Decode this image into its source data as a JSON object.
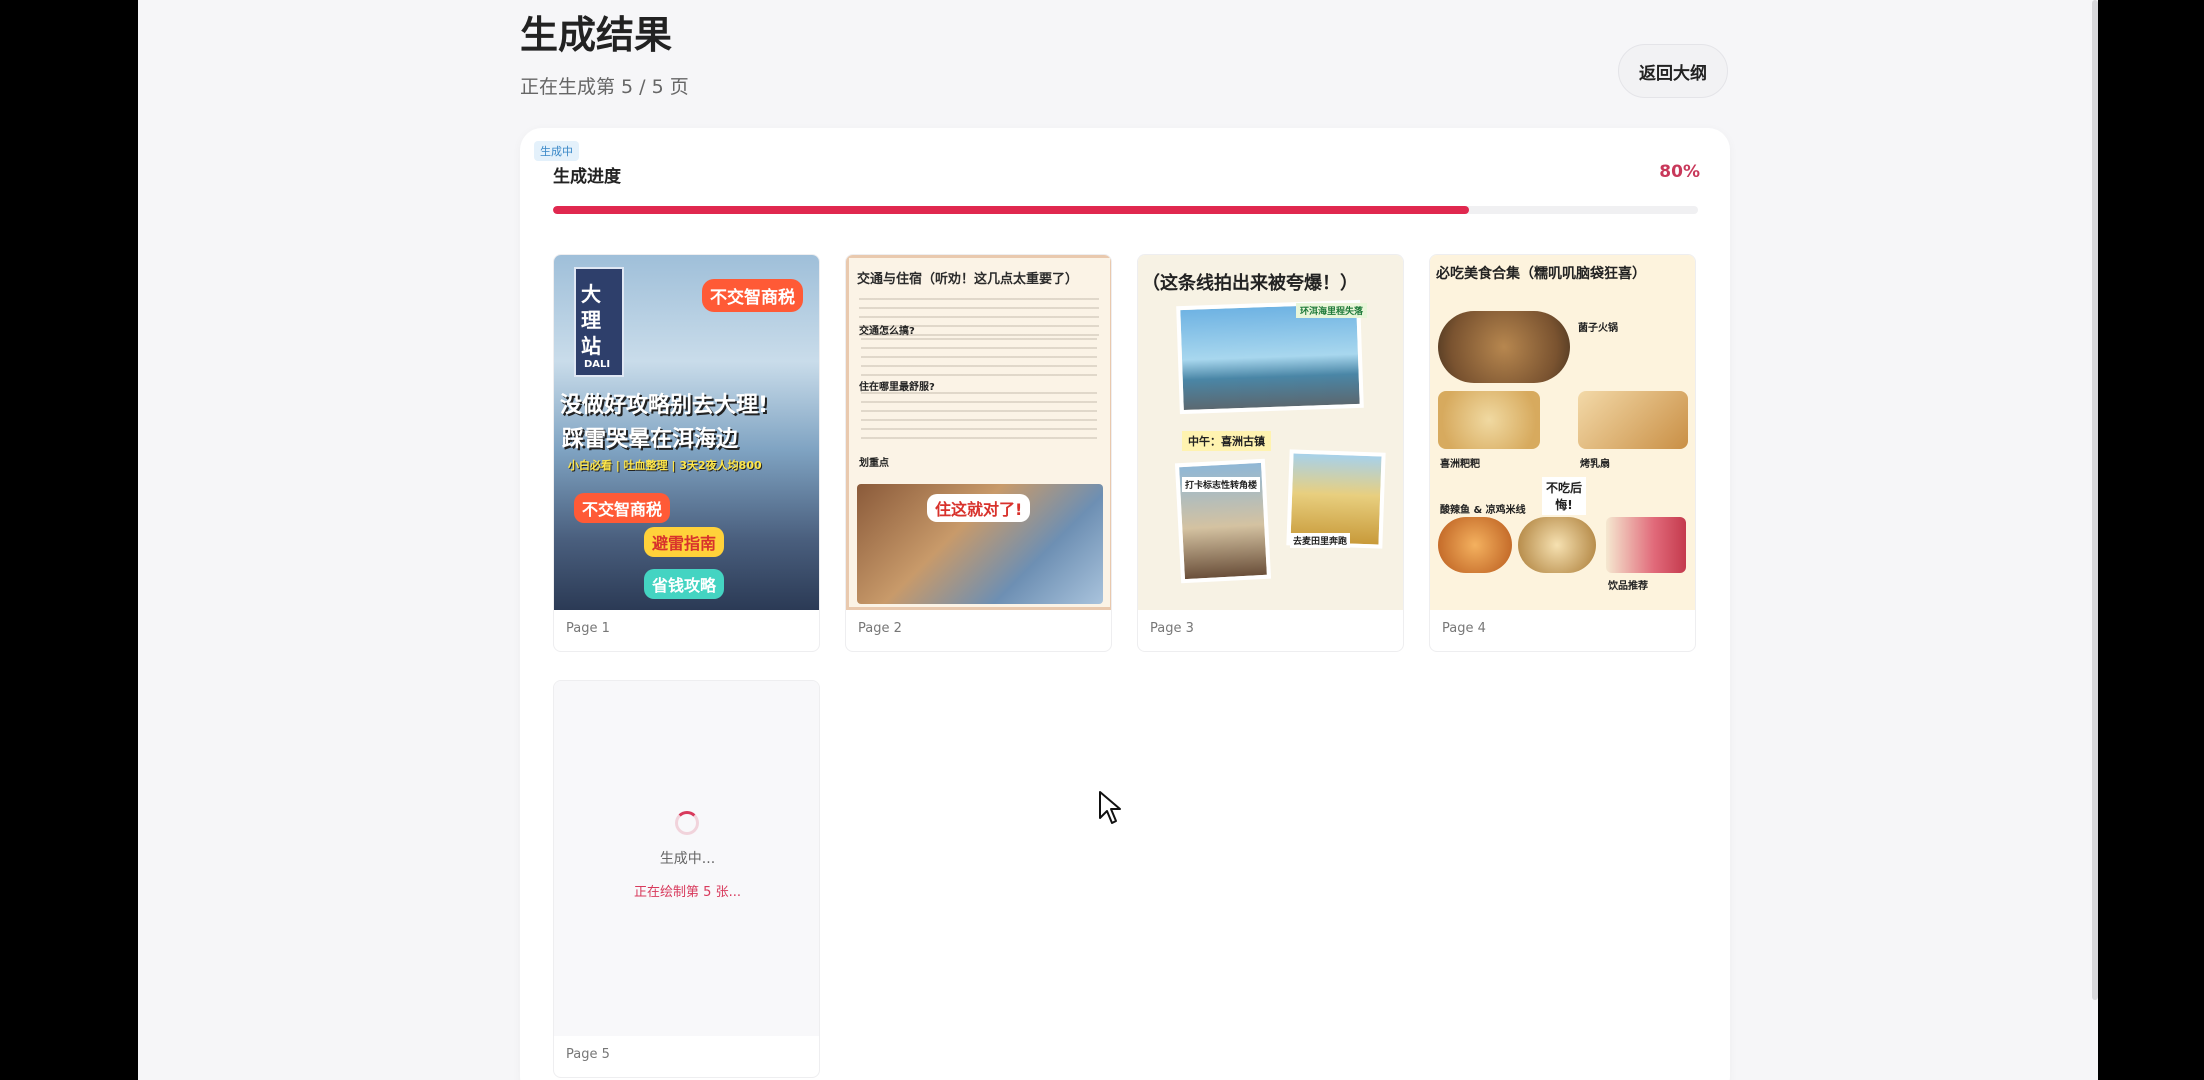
{
  "header": {
    "title": "生成结果",
    "subtitle": "正在生成第 5 / 5 页",
    "back_label": "返回大纲"
  },
  "progress": {
    "badge": "生成中",
    "label": "生成进度",
    "percent_text": "80%",
    "value": 0.8
  },
  "cards": [
    {
      "page_label": "Page 1",
      "lines": [
        "大理站",
        "DALI",
        "不交智商税",
        "没做好攻略别去大理!",
        "踩雷哭晕在洱海边",
        "小白必看 | 吐血整理 | 3天2夜人均800",
        "不交智商税",
        "避雷指南",
        "省钱攻略"
      ]
    },
    {
      "page_label": "Page 2",
      "lines": [
        "交通与住宿（听劝！这几点太重要了）",
        "交通怎么搞?",
        "住在哪里最舒服?",
        "划重点",
        "住这就对了!"
      ]
    },
    {
      "page_label": "Page 3",
      "lines": [
        "（这条线拍出来被夸爆！）",
        "环洱海里程失落",
        "中午：喜洲古镇",
        "打卡标志性转角楼",
        "去麦田里奔跑"
      ]
    },
    {
      "page_label": "Page 4",
      "lines": [
        "必吃美食合集（糯叽叽脑袋狂喜）",
        "菌子火锅",
        "喜洲粑粑",
        "烤乳扇",
        "不吃后悔!",
        "酸辣鱼 & 凉鸡米线",
        "饮品推荐"
      ]
    }
  ],
  "loading_card": {
    "page_label": "Page 5",
    "status": "生成中...",
    "substatus": "正在绘制第 5 张..."
  },
  "colors": {
    "accent": "#e0284f",
    "badge_bg": "#e4f1fb",
    "badge_text": "#3a88c7"
  },
  "icons": [
    "cursor-icon",
    "loading-spinner-icon"
  ]
}
